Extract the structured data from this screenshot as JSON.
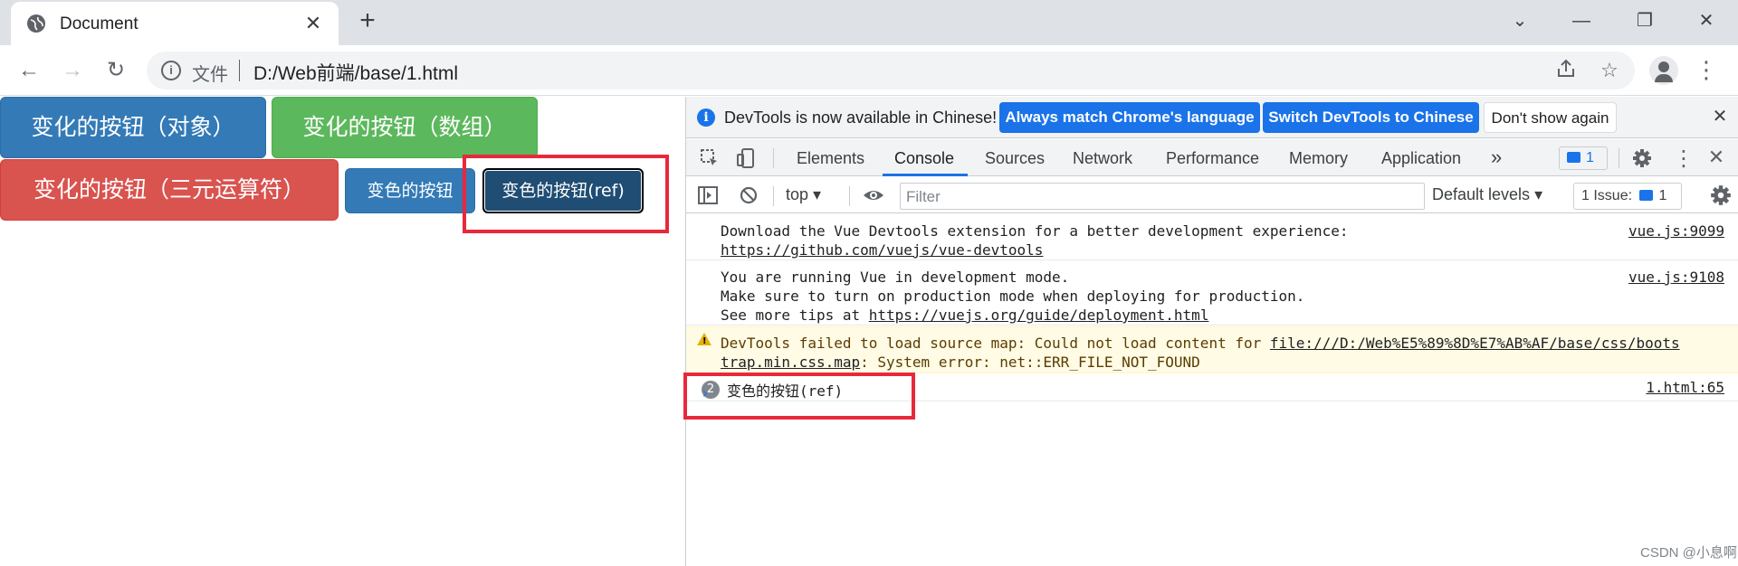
{
  "browser": {
    "tab_title": "Document",
    "tab_close": "✕",
    "new_tab": "+",
    "window": {
      "minimize": "—",
      "restore": "❐",
      "close": "✕",
      "tab_search": "⌄"
    },
    "nav": {
      "back": "←",
      "forward": "→",
      "reload": "↻"
    },
    "omnibox": {
      "scheme_label": "文件",
      "url": "D:/Web前端/base/1.html"
    }
  },
  "page": {
    "buttons": {
      "object": "变化的按钮（对象）",
      "array": "变化的按钮（数组）",
      "ternary": "变化的按钮（三元运算符）",
      "color": "变色的按钮",
      "color_ref": "变色的按钮(ref)"
    }
  },
  "devtools": {
    "infobar": {
      "text": "DevTools is now available in Chinese!",
      "match_label": "Always match Chrome's language",
      "switch_label": "Switch DevTools to Chinese",
      "dont_show_label": "Don't show again",
      "close": "✕"
    },
    "tabs": [
      "Elements",
      "Console",
      "Sources",
      "Network",
      "Performance",
      "Memory",
      "Application"
    ],
    "more_tabs": "»",
    "issues_count": "1",
    "filter": {
      "context": "top",
      "placeholder": "Filter",
      "levels": "Default levels",
      "issue_label": "1 Issue:",
      "issue_count": "1"
    },
    "console": {
      "messages": [
        {
          "lines": [
            "Download the Vue Devtools extension for a better development experience:"
          ],
          "link": "https://github.com/vuejs/vue-devtools",
          "source": "vue.js:9099"
        },
        {
          "lines": [
            "You are running Vue in development mode.",
            "Make sure to turn on production mode when deploying for production."
          ],
          "prefix": "See more tips at ",
          "link": "https://vuejs.org/guide/deployment.html",
          "source": "vue.js:9108"
        },
        {
          "prefix": "DevTools failed to load source map: Could not load content for ",
          "link1": "file:///D:/Web%E5%89%8D%E7%AB%AF/base/css/boots",
          "link2": "trap.min.css.map",
          "suffix": ": System error: net::ERR_FILE_NOT_FOUND",
          "level": "warning"
        },
        {
          "repeat": "2",
          "text": "变色的按钮(ref)",
          "source": "1.html:65"
        }
      ],
      "prompt": "›"
    }
  },
  "watermark": "CSDN @小息啊",
  "colors": {
    "primary": "#337ab7",
    "success": "#5cb85c",
    "danger": "#d9534f",
    "highlight": "#e8293b",
    "devtools_blue": "#1a73e8"
  }
}
